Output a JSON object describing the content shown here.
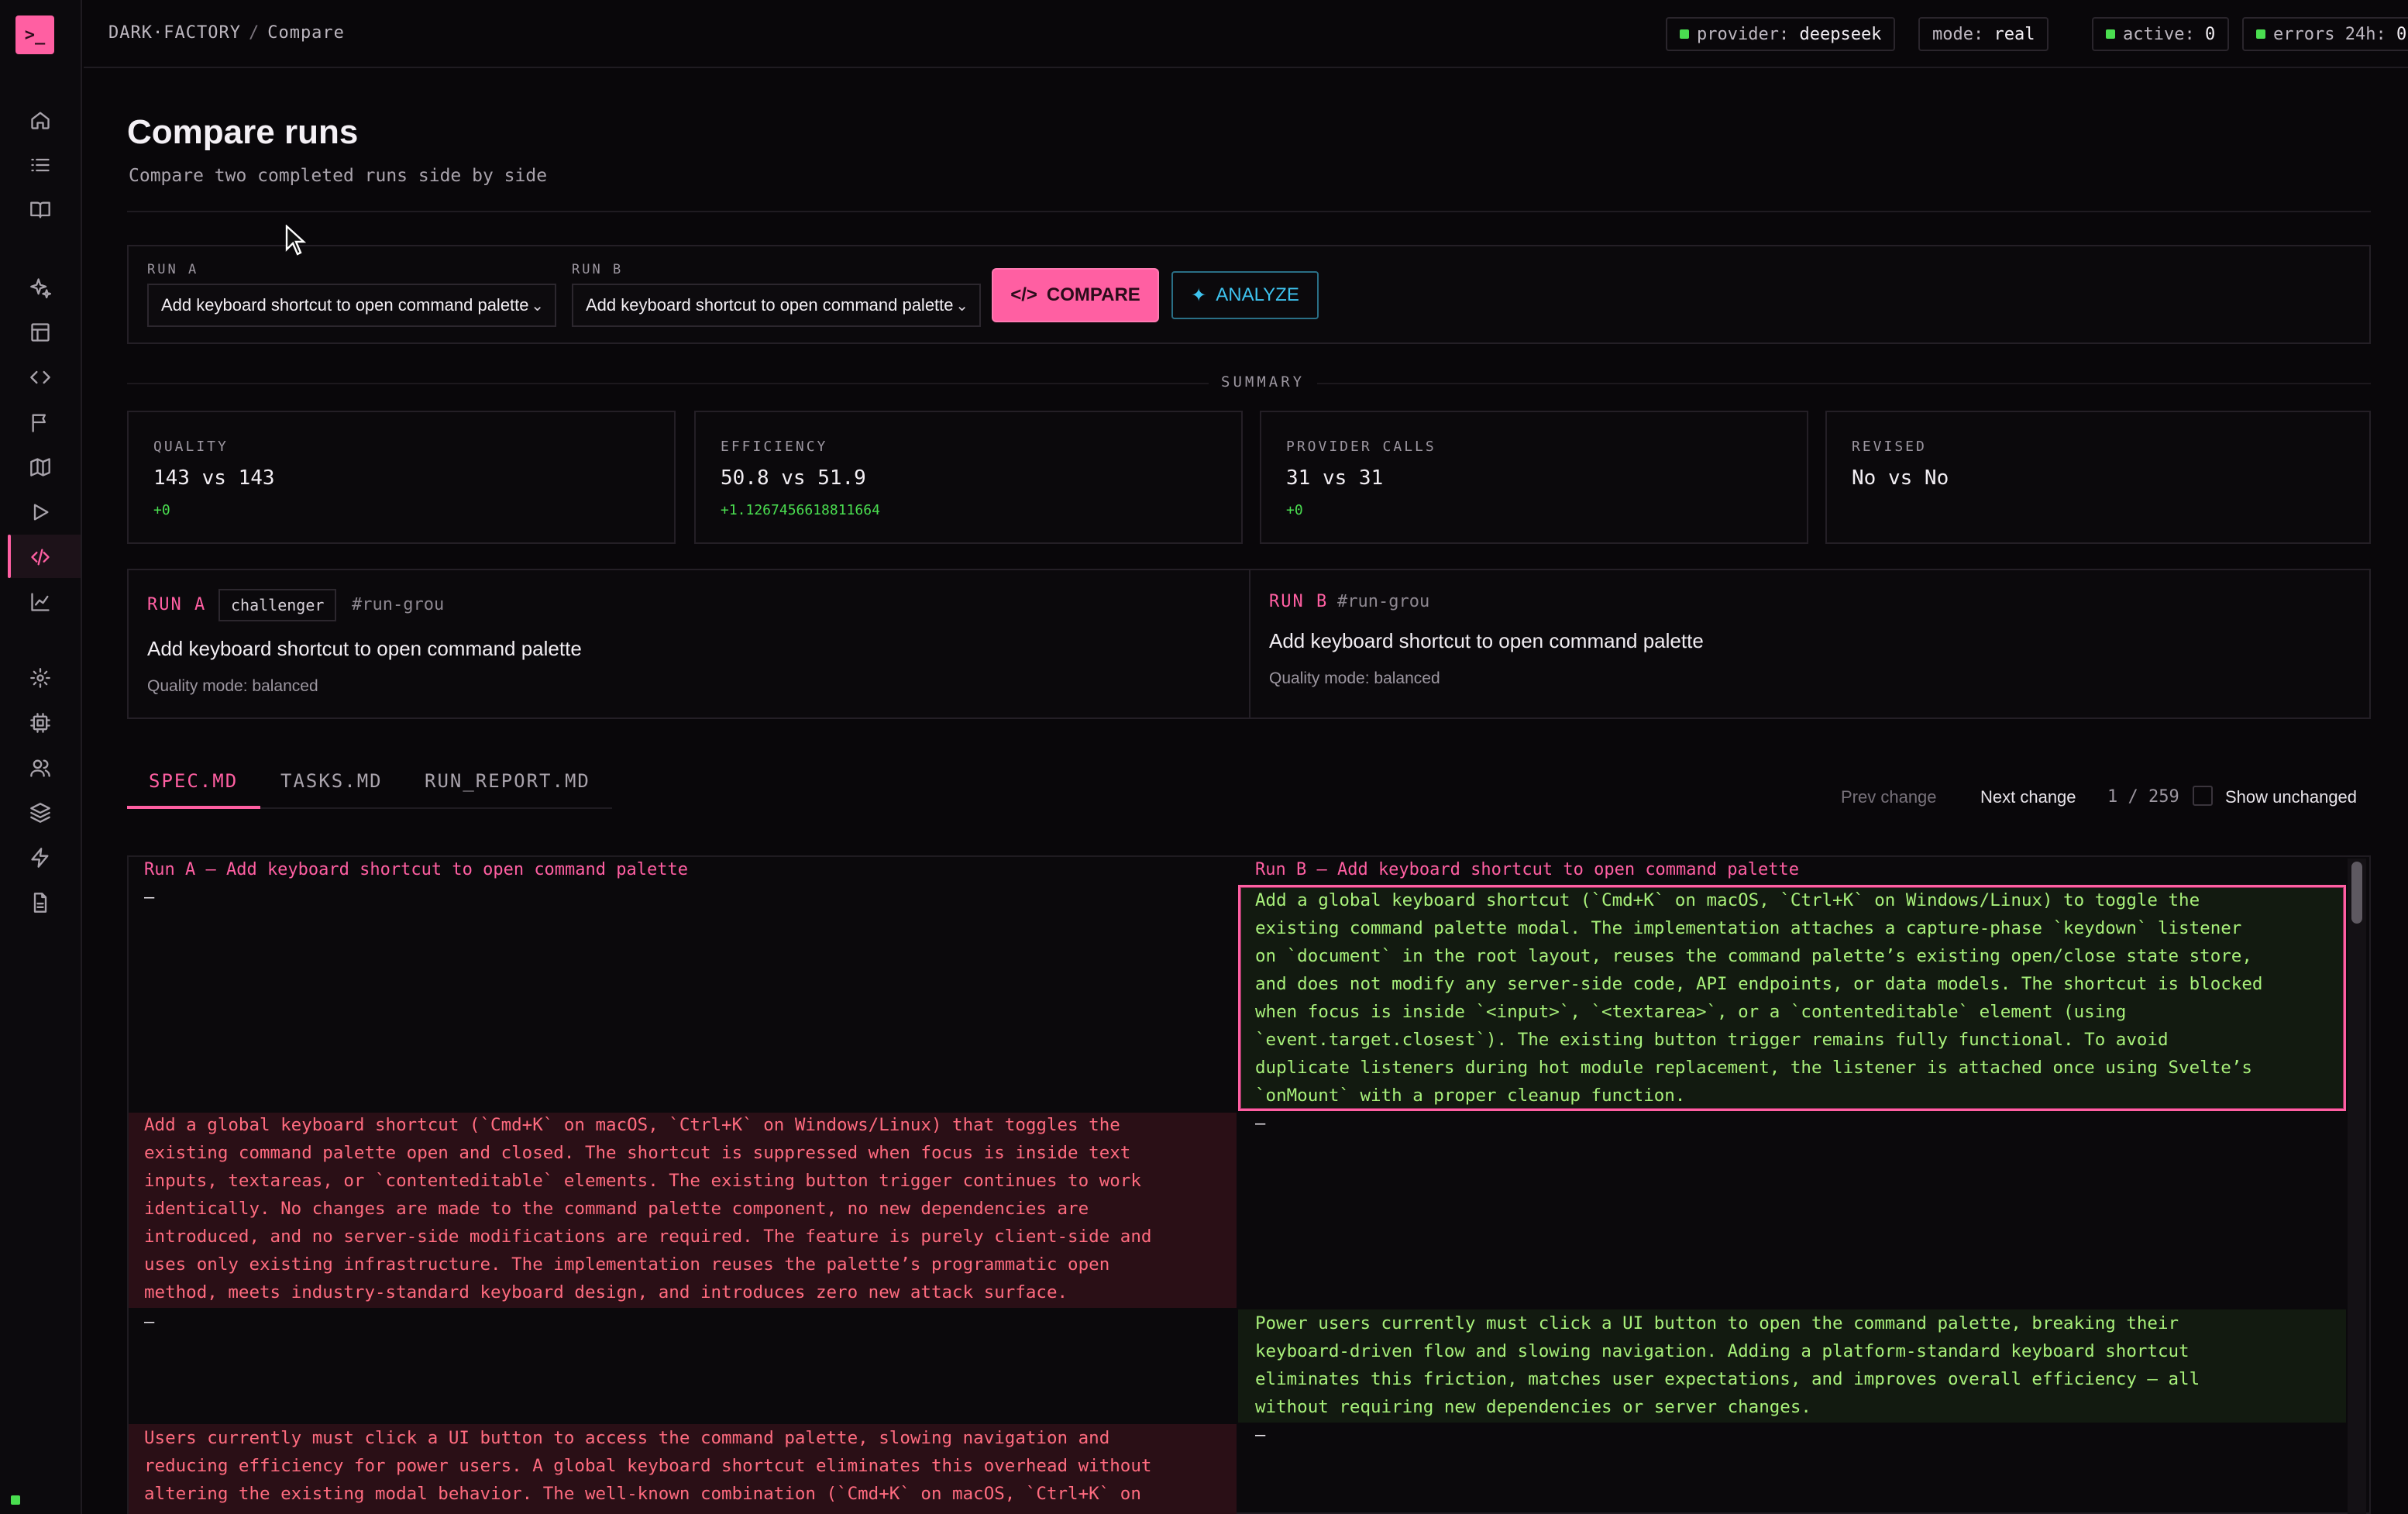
{
  "app": {
    "brand": "DARK·FACTORY",
    "page": "Compare",
    "logo_glyph": ">_"
  },
  "status": {
    "provider_label": "provider:",
    "provider": "deepseek",
    "mode_label": "mode:",
    "mode": "real",
    "active_label": "active:",
    "active": "0",
    "errors_label": "errors 24h:",
    "errors": "0"
  },
  "sidebar": {
    "icons": [
      "home-icon",
      "list-icon",
      "book-icon",
      "sparkles-icon",
      "layout-icon",
      "code-icon",
      "flag-icon",
      "map-icon",
      "play-icon",
      "compare-icon",
      "chart-icon",
      "settings-icon",
      "cpu-icon",
      "users-icon",
      "layers-icon",
      "zap-icon",
      "file-icon"
    ],
    "active": "compare-icon"
  },
  "header": {
    "title": "Compare runs",
    "subtitle": "Compare two completed runs side by side"
  },
  "form": {
    "run_a_label": "RUN A",
    "run_a_value": "Add keyboard shortcut to open command palette",
    "run_b_label": "RUN B",
    "run_b_value": "Add keyboard shortcut to open command palette",
    "compare_label": "COMPARE",
    "analyze_label": "ANALYZE"
  },
  "summary": {
    "heading": "SUMMARY",
    "cards": [
      {
        "label": "QUALITY",
        "value": "143 vs 143",
        "delta": "+0"
      },
      {
        "label": "EFFICIENCY",
        "value": "50.8 vs 51.9",
        "delta": "+1.1267456618811664"
      },
      {
        "label": "PROVIDER CALLS",
        "value": "31 vs 31",
        "delta": "+0"
      },
      {
        "label": "REVISED",
        "value": "No vs No",
        "delta": ""
      }
    ]
  },
  "runs": {
    "a": {
      "tag": "RUN A",
      "badge": "challenger",
      "hash": "#run-grou",
      "title": "Add keyboard shortcut to open command palette",
      "meta": "Quality mode: balanced"
    },
    "b": {
      "tag": "RUN B",
      "hash": "#run-grou",
      "title": "Add keyboard shortcut to open command palette",
      "meta": "Quality mode: balanced"
    }
  },
  "tabs": [
    "SPEC.MD",
    "TASKS.MD",
    "RUN_REPORT.MD"
  ],
  "diff_controls": {
    "prev": "Prev change",
    "next": "Next change",
    "position": "1 / 259",
    "show_unchanged": "Show unchanged"
  },
  "diff": {
    "header_a": "Run A — Add keyboard shortcut to open command palette",
    "header_b": "Run B — Add keyboard shortcut to open command palette",
    "dash": "—",
    "b_block1": "Add a global keyboard shortcut (`Cmd+K` on macOS, `Ctrl+K` on Windows/Linux) to toggle the\nexisting command palette modal. The implementation attaches a capture-phase `keydown` listener\non `document` in the root layout, reuses the command palette’s existing open/close state store,\nand does not modify any server-side code, API endpoints, or data models. The shortcut is blocked\nwhen focus is inside `<input>`, `<textarea>`, or a `contenteditable` element (using\n`event.target.closest`). The existing button trigger remains fully functional. To avoid\nduplicate listeners during hot module replacement, the listener is attached once using Svelte’s\n`onMount` with a proper cleanup function.",
    "a_block1": "Add a global keyboard shortcut (`Cmd+K` on macOS, `Ctrl+K` on Windows/Linux) that toggles the\nexisting command palette open and closed. The shortcut is suppressed when focus is inside text\ninputs, textareas, or `contenteditable` elements. The existing button trigger continues to work\nidentically. No changes are made to the command palette component, no new dependencies are\nintroduced, and no server-side modifications are required. The feature is purely client-side and\nuses only existing infrastructure. The implementation reuses the palette’s programmatic open\nmethod, meets industry-standard keyboard design, and introduces zero new attack surface.",
    "b_block2": "Power users currently must click a UI button to open the command palette, breaking their\nkeyboard-driven flow and slowing navigation. Adding a platform-standard keyboard shortcut\neliminates this friction, matches user expectations, and improves overall efficiency — all\nwithout requiring new dependencies or server changes.",
    "a_block2": "Users currently must click a UI button to access the command palette, slowing navigation and\nreducing efficiency for power users. A global keyboard shortcut eliminates this overhead without\naltering the existing modal behavior. The well-known combination (`Cmd+K` on macOS, `Ctrl+K` on"
  },
  "colors": {
    "accent": "#ff5fa2",
    "analyze": "#3ec3ef",
    "ok": "#4ade50",
    "removed": "#ff6b7f",
    "added": "#a8f07a"
  }
}
